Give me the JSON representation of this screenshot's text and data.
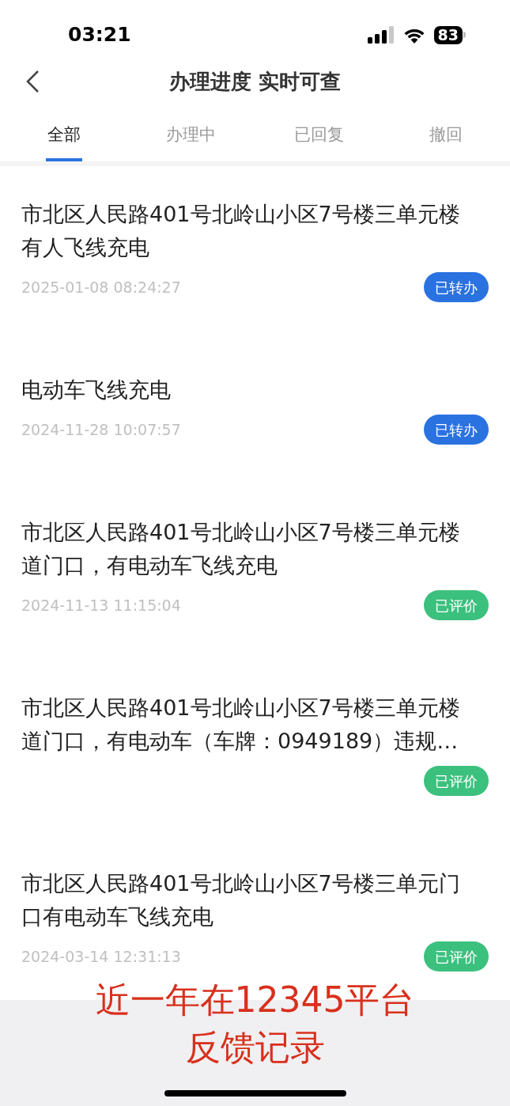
{
  "status_bar": {
    "time": "03:21",
    "battery": "83"
  },
  "header": {
    "title": "办理进度 实时可查"
  },
  "tabs": [
    {
      "label": "全部",
      "selected": true
    },
    {
      "label": "办理中",
      "selected": false
    },
    {
      "label": "已回复",
      "selected": false
    },
    {
      "label": "撤回",
      "selected": false
    }
  ],
  "items": [
    {
      "title": "市北区人民路401号北岭山小区7号楼三单元楼有人飞线充电",
      "date": "2025-01-08 08:24:27",
      "status": {
        "label": "已转办",
        "kind": "transferred"
      }
    },
    {
      "title": "电动车飞线充电",
      "date": "2024-11-28 10:07:57",
      "status": {
        "label": "已转办",
        "kind": "transferred"
      }
    },
    {
      "title": "市北区人民路401号北岭山小区7号楼三单元楼道门口，有电动车飞线充电",
      "date": "2024-11-13 11:15:04",
      "status": {
        "label": "已评价",
        "kind": "rated"
      }
    },
    {
      "title": "市北区人民路401号北岭山小区7号楼三单元楼道门口，有电动车（车牌：0949189）违规…",
      "status": {
        "label": "已评价",
        "kind": "rated"
      }
    },
    {
      "title": "市北区人民路401号北岭山小区7号楼三单元门口有电动车飞线充电",
      "date": "2024-03-14 12:31:13",
      "status": {
        "label": "已评价",
        "kind": "rated"
      }
    }
  ],
  "caption": {
    "lines": [
      "近一年在12345平台",
      "反馈记录"
    ]
  }
}
